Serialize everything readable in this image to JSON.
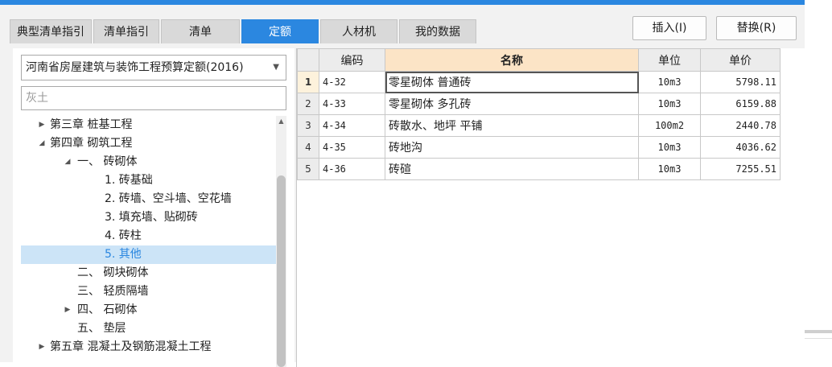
{
  "tabs": [
    {
      "label": "典型清单指引",
      "active": false
    },
    {
      "label": "清单指引",
      "active": false
    },
    {
      "label": "清单",
      "active": false
    },
    {
      "label": "定额",
      "active": true
    },
    {
      "label": "人材机",
      "active": false
    },
    {
      "label": "我的数据",
      "active": false
    }
  ],
  "buttons": {
    "insert": "插入(I)",
    "replace": "替换(R)"
  },
  "library": {
    "selected": "河南省房屋建筑与装饰工程预算定额(2016)"
  },
  "search": {
    "value": "灰土"
  },
  "tree": [
    {
      "label": "第三章 桩基工程",
      "twisty": "▶",
      "level": 0
    },
    {
      "label": "第四章 砌筑工程",
      "twisty": "◢",
      "level": 0
    },
    {
      "label": "一、 砖砌体",
      "twisty": "◢",
      "level": 1
    },
    {
      "label": "1. 砖基础",
      "twisty": "",
      "level": 2
    },
    {
      "label": "2. 砖墙、空斗墙、空花墙",
      "twisty": "",
      "level": 2
    },
    {
      "label": "3. 填充墙、贴砌砖",
      "twisty": "",
      "level": 2
    },
    {
      "label": "4. 砖柱",
      "twisty": "",
      "level": 2
    },
    {
      "label": "5. 其他",
      "twisty": "",
      "level": 2,
      "selected": true
    },
    {
      "label": "二、 砌块砌体",
      "twisty": "",
      "level": 1
    },
    {
      "label": "三、 轻质隔墙",
      "twisty": "",
      "level": 1
    },
    {
      "label": "四、 石砌体",
      "twisty": "▶",
      "level": 1
    },
    {
      "label": "五、 垫层",
      "twisty": "",
      "level": 1
    },
    {
      "label": "第五章 混凝土及钢筋混凝土工程",
      "twisty": "▶",
      "level": 0
    }
  ],
  "grid": {
    "columns": [
      "编码",
      "名称",
      "单位",
      "单价"
    ],
    "rows": [
      {
        "num": "1",
        "code": "4-32",
        "name": "零星砌体 普通砖",
        "unit": "10m3",
        "price": "5798.11"
      },
      {
        "num": "2",
        "code": "4-33",
        "name": "零星砌体 多孔砖",
        "unit": "10m3",
        "price": "6159.88"
      },
      {
        "num": "3",
        "code": "4-34",
        "name": "砖散水、地坪 平铺",
        "unit": "100m2",
        "price": "2440.78"
      },
      {
        "num": "4",
        "code": "4-35",
        "name": "砖地沟",
        "unit": "10m3",
        "price": "4036.62"
      },
      {
        "num": "5",
        "code": "4-36",
        "name": "砖碹",
        "unit": "10m3",
        "price": "7255.51"
      }
    ]
  },
  "colors": {
    "accent": "#2b87e0",
    "selection": "#cce4f7",
    "header_highlight": "#fce4c6"
  }
}
